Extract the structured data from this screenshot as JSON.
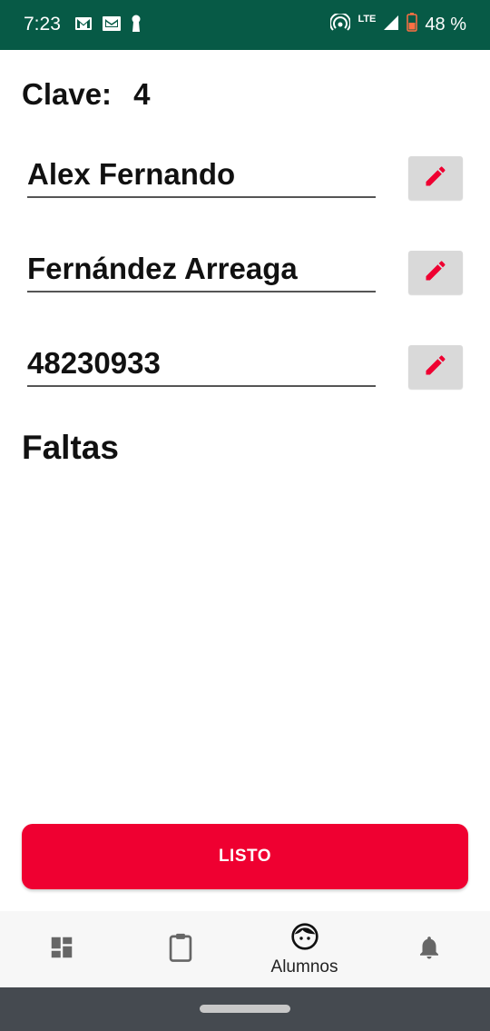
{
  "status_bar": {
    "time": "7:23",
    "network": "LTE",
    "battery": "48 %",
    "icons_left": [
      "gmail-icon",
      "inbox-icon",
      "keyhole-icon"
    ],
    "icons_right": [
      "hotspot-icon",
      "signal-icon",
      "battery-icon"
    ],
    "background_color": "#075a46"
  },
  "clave": {
    "label": "Clave:",
    "value": "4"
  },
  "fields": [
    {
      "value": "Alex Fernando",
      "edit_icon": "pencil-icon"
    },
    {
      "value": "Fernández Arreaga",
      "edit_icon": "pencil-icon"
    },
    {
      "value": "48230933",
      "edit_icon": "pencil-icon"
    }
  ],
  "faltas_title": "Faltas",
  "listo_button": {
    "label": "LISTO",
    "color": "#ef0031"
  },
  "bottom_nav": {
    "items": [
      {
        "icon": "dashboard-icon",
        "label": ""
      },
      {
        "icon": "clipboard-icon",
        "label": ""
      },
      {
        "icon": "face-icon",
        "label": "Alumnos",
        "active": true
      },
      {
        "icon": "bell-icon",
        "label": ""
      }
    ]
  },
  "accent_color": "#ef0031"
}
